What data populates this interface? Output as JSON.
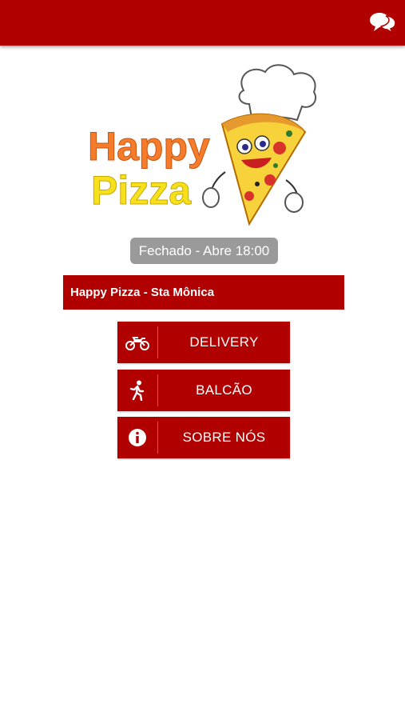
{
  "header": {
    "chat_icon": "chat-bubbles-icon",
    "brand_color": "#b00000"
  },
  "logo": {
    "line1": "Happy",
    "line2": "Pizza",
    "line1_color": "#f57c2a",
    "line2_color": "#f7e11a"
  },
  "status": {
    "text": "Fechado - Abre 18:00"
  },
  "store": {
    "name": "Happy Pizza - Sta Mônica"
  },
  "menu": {
    "delivery": {
      "label": "DELIVERY",
      "icon": "motorcycle-icon"
    },
    "balcao": {
      "label": "BALCÃO",
      "icon": "running-person-icon"
    },
    "sobre": {
      "label": "SOBRE NÓS",
      "icon": "info-icon"
    }
  }
}
